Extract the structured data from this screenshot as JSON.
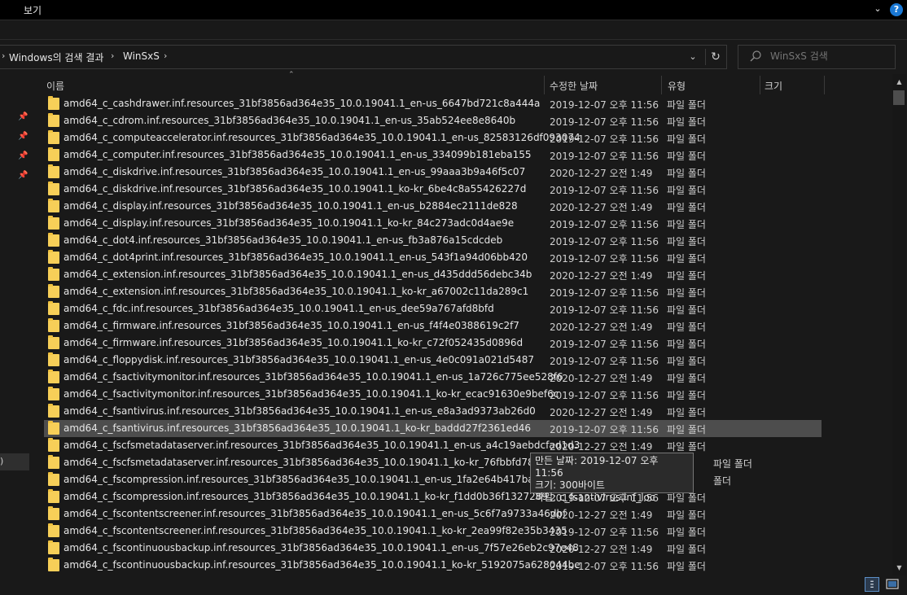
{
  "ribbon": {
    "tab_view": "보기",
    "expand_icon": "chevron-down-icon",
    "help": "?"
  },
  "address": {
    "crumbs": [
      "Windows의 검색 결과",
      "WinSxS"
    ]
  },
  "search": {
    "placeholder": "WinSxS 검색"
  },
  "columns": {
    "name": "이름",
    "date": "수정한 날짜",
    "type": "유형",
    "size": "크기"
  },
  "rows": [
    {
      "name": "amd64_c_cashdrawer.inf.resources_31bf3856ad364e35_10.0.19041.1_en-us_6647bd721c8a444a",
      "date": "2019-12-07 오후 11:56",
      "type": "파일 폴더"
    },
    {
      "name": "amd64_c_cdrom.inf.resources_31bf3856ad364e35_10.0.19041.1_en-us_35ab524ee8e8640b",
      "date": "2019-12-07 오후 11:56",
      "type": "파일 폴더"
    },
    {
      "name": "amd64_c_computeaccelerator.inf.resources_31bf3856ad364e35_10.0.19041.1_en-us_82583126df093074",
      "date": "2019-12-07 오후 11:56",
      "type": "파일 폴더"
    },
    {
      "name": "amd64_c_computer.inf.resources_31bf3856ad364e35_10.0.19041.1_en-us_334099b181eba155",
      "date": "2019-12-07 오후 11:56",
      "type": "파일 폴더"
    },
    {
      "name": "amd64_c_diskdrive.inf.resources_31bf3856ad364e35_10.0.19041.1_en-us_99aaa3b9a46f5c07",
      "date": "2020-12-27 오전 1:49",
      "type": "파일 폴더"
    },
    {
      "name": "amd64_c_diskdrive.inf.resources_31bf3856ad364e35_10.0.19041.1_ko-kr_6be4c8a55426227d",
      "date": "2019-12-07 오후 11:56",
      "type": "파일 폴더"
    },
    {
      "name": "amd64_c_display.inf.resources_31bf3856ad364e35_10.0.19041.1_en-us_b2884ec2111de828",
      "date": "2020-12-27 오전 1:49",
      "type": "파일 폴더"
    },
    {
      "name": "amd64_c_display.inf.resources_31bf3856ad364e35_10.0.19041.1_ko-kr_84c273adc0d4ae9e",
      "date": "2019-12-07 오후 11:56",
      "type": "파일 폴더"
    },
    {
      "name": "amd64_c_dot4.inf.resources_31bf3856ad364e35_10.0.19041.1_en-us_fb3a876a15cdcdeb",
      "date": "2019-12-07 오후 11:56",
      "type": "파일 폴더"
    },
    {
      "name": "amd64_c_dot4print.inf.resources_31bf3856ad364e35_10.0.19041.1_en-us_543f1a94d06bb420",
      "date": "2019-12-07 오후 11:56",
      "type": "파일 폴더"
    },
    {
      "name": "amd64_c_extension.inf.resources_31bf3856ad364e35_10.0.19041.1_en-us_d435ddd56debc34b",
      "date": "2020-12-27 오전 1:49",
      "type": "파일 폴더"
    },
    {
      "name": "amd64_c_extension.inf.resources_31bf3856ad364e35_10.0.19041.1_ko-kr_a67002c11da289c1",
      "date": "2019-12-07 오후 11:56",
      "type": "파일 폴더"
    },
    {
      "name": "amd64_c_fdc.inf.resources_31bf3856ad364e35_10.0.19041.1_en-us_dee59a767afd8bfd",
      "date": "2019-12-07 오후 11:56",
      "type": "파일 폴더"
    },
    {
      "name": "amd64_c_firmware.inf.resources_31bf3856ad364e35_10.0.19041.1_en-us_f4f4e0388619c2f7",
      "date": "2020-12-27 오전 1:49",
      "type": "파일 폴더"
    },
    {
      "name": "amd64_c_firmware.inf.resources_31bf3856ad364e35_10.0.19041.1_ko-kr_c72f052435d0896d",
      "date": "2019-12-07 오후 11:56",
      "type": "파일 폴더"
    },
    {
      "name": "amd64_c_floppydisk.inf.resources_31bf3856ad364e35_10.0.19041.1_en-us_4e0c091a021d5487",
      "date": "2019-12-07 오후 11:56",
      "type": "파일 폴더"
    },
    {
      "name": "amd64_c_fsactivitymonitor.inf.resources_31bf3856ad364e35_10.0.19041.1_en-us_1a726c775ee528f6",
      "date": "2020-12-27 오전 1:49",
      "type": "파일 폴더"
    },
    {
      "name": "amd64_c_fsactivitymonitor.inf.resources_31bf3856ad364e35_10.0.19041.1_ko-kr_ecac91630e9bef6c",
      "date": "2019-12-07 오후 11:56",
      "type": "파일 폴더"
    },
    {
      "name": "amd64_c_fsantivirus.inf.resources_31bf3856ad364e35_10.0.19041.1_en-us_e8a3ad9373ab26d0",
      "date": "2020-12-27 오전 1:49",
      "type": "파일 폴더"
    },
    {
      "name": "amd64_c_fsantivirus.inf.resources_31bf3856ad364e35_10.0.19041.1_ko-kr_baddd27f2361ed46",
      "date": "2019-12-07 오후 11:56",
      "type": "파일 폴더",
      "selected": true
    },
    {
      "name": "amd64_c_fscfsmetadataserver.inf.resources_31bf3856ad364e35_10.0.19041.1_en-us_a4c19aebdcfad1d3",
      "date": "2020-12-27 오전 1:49",
      "type": "파일 폴더"
    },
    {
      "name": "amd64_c_fscfsmetadataserver.inf.resources_31bf3856ad364e35_10.0.19041.1_ko-kr_76fbbfd78cb19849",
      "date": "",
      "type": "파일 폴더"
    },
    {
      "name": "amd64_c_fscompression.inf.resources_31bf3856ad364e35_10.0.19041.1_en-us_1fa2e64b417bac13",
      "date": "",
      "type": "폴더"
    },
    {
      "name": "amd64_c_fscompression.inf.resources_31bf3856ad364e35_10.0.19041.1_ko-kr_f1dd0b36f1327289",
      "date": "2019-12-07 오후 11:56",
      "type": "파일 폴더"
    },
    {
      "name": "amd64_c_fscontentscreener.inf.resources_31bf3856ad364e35_10.0.19041.1_en-us_5c6f7a9733a46dbf",
      "date": "2020-12-27 오전 1:49",
      "type": "파일 폴더"
    },
    {
      "name": "amd64_c_fscontentscreener.inf.resources_31bf3856ad364e35_10.0.19041.1_ko-kr_2ea99f82e35b3435",
      "date": "2019-12-07 오후 11:56",
      "type": "파일 폴더"
    },
    {
      "name": "amd64_c_fscontinuousbackup.inf.resources_31bf3856ad364e35_10.0.19041.1_en-us_7f57e26eb2c97e48",
      "date": "2020-12-27 오전 1:49",
      "type": "파일 폴더"
    },
    {
      "name": "amd64_c_fscontinuousbackup.inf.resources_31bf3856ad364e35_10.0.19041.1_ko-kr_5192075a628044be",
      "date": "2019-12-07 오후 11:56",
      "type": "파일 폴더"
    }
  ],
  "tooltip": {
    "line1": "만든 날짜: 2019-12-07 오후 11:56",
    "line2": "크기: 300바이트",
    "line3": "파일: c_fsantivirus.inf_loc"
  },
  "nav": {
    "selected_text": ")"
  },
  "colors": {
    "folder": "#f7cf58",
    "selected_row": "#4d4d4d",
    "help_button": "#1a78d4"
  }
}
